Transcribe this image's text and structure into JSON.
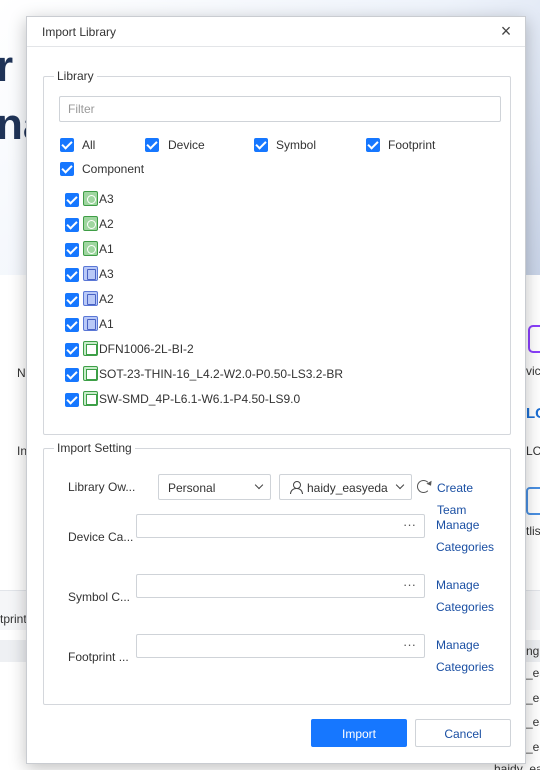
{
  "background": {
    "hero_text_1": "r u",
    "hero_text_2": "na",
    "left_labels": [
      "N",
      "In"
    ],
    "right_labels": [
      "vic",
      "LC",
      "tlis"
    ],
    "band_left": "tprint",
    "band_right": "ng",
    "right_rows": [
      "_ea",
      "_ea",
      "_ea",
      "_ea",
      "haidy_ea"
    ],
    "logo_text": "LC"
  },
  "dialog": {
    "title": "Import Library",
    "close_label": "×",
    "library": {
      "legend": "Library",
      "filter_placeholder": "Filter",
      "types": [
        "All",
        "Device",
        "Symbol",
        "Footprint",
        "Component"
      ],
      "items": [
        {
          "label": "A3",
          "icon": "symbol-icon"
        },
        {
          "label": "A2",
          "icon": "symbol-icon"
        },
        {
          "label": "A1",
          "icon": "symbol-icon"
        },
        {
          "label": "A3",
          "icon": "footprint-icon"
        },
        {
          "label": "A2",
          "icon": "footprint-icon"
        },
        {
          "label": "A1",
          "icon": "footprint-icon"
        },
        {
          "label": "DFN1006-2L-BI-2",
          "icon": "device-icon"
        },
        {
          "label": "SOT-23-THIN-16_L4.2-W2.0-P0.50-LS3.2-BR",
          "icon": "device-icon"
        },
        {
          "label": "SW-SMD_4P-L6.1-W6.1-P4.50-LS9.0",
          "icon": "device-icon"
        }
      ]
    },
    "import_setting": {
      "legend": "Import Setting",
      "owner_label": "Library Ow...",
      "owner_value": "Personal",
      "user_value": "haidy_easyeda",
      "create_team": "Create Team",
      "device_label": "Device Ca...",
      "symbol_label": "Symbol C...",
      "footprint_label": "Footprint ...",
      "manage_categories": "Manage Categories",
      "dots": "···"
    },
    "buttons": {
      "import": "Import",
      "cancel": "Cancel"
    }
  },
  "colors": {
    "accent": "#1677ff",
    "link": "#1a4fa3"
  }
}
